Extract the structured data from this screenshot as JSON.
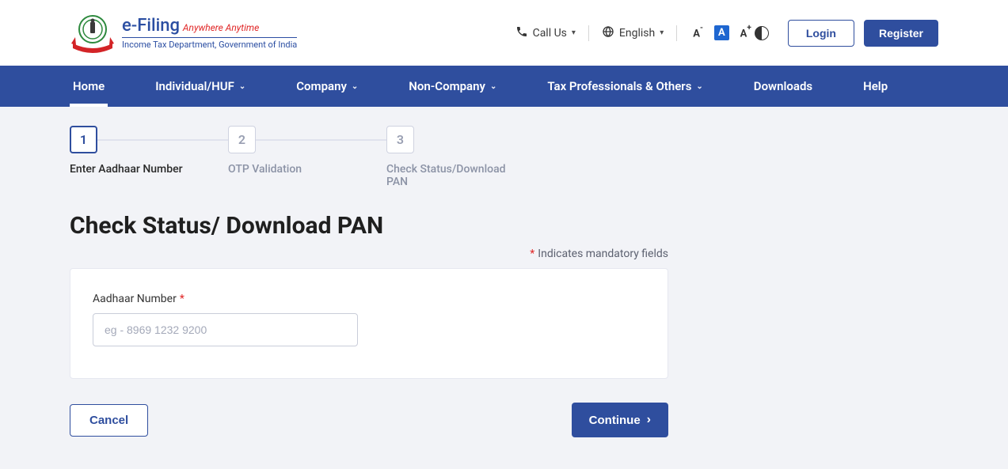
{
  "header": {
    "brand_main": "e-Filing",
    "brand_tagline": "Anywhere Anytime",
    "brand_sub": "Income Tax Department, Government of India",
    "call_us": "Call Us",
    "language": "English",
    "font_small": "A",
    "font_mid": "A",
    "font_large": "A",
    "login": "Login",
    "register": "Register"
  },
  "nav": {
    "home": "Home",
    "individual": "Individual/HUF",
    "company": "Company",
    "noncompany": "Non-Company",
    "taxpros": "Tax Professionals & Others",
    "downloads": "Downloads",
    "help": "Help"
  },
  "stepper": {
    "s1_num": "1",
    "s1_label": "Enter Aadhaar Number",
    "s2_num": "2",
    "s2_label": "OTP Validation",
    "s3_num": "3",
    "s3_label": "Check Status/Download PAN"
  },
  "page": {
    "title": "Check Status/ Download PAN",
    "mandatory": "Indicates mandatory fields"
  },
  "form": {
    "aadhaar_label": "Aadhaar Number",
    "aadhaar_placeholder": "eg - 8969 1232 9200",
    "aadhaar_value": ""
  },
  "buttons": {
    "cancel": "Cancel",
    "continue": "Continue"
  }
}
